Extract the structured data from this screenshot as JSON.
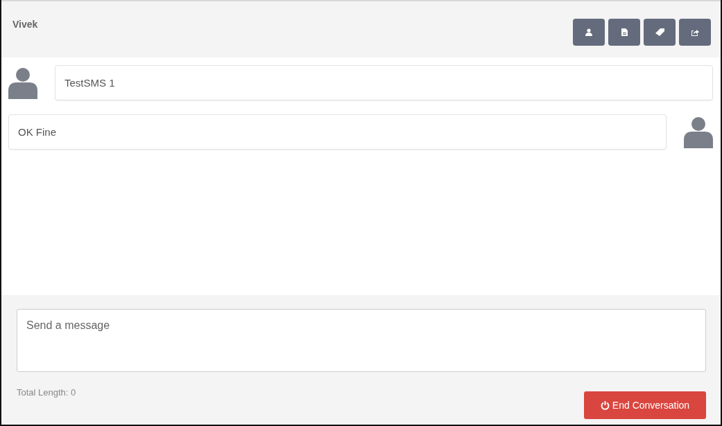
{
  "contact": {
    "name": "Vivek"
  },
  "toolbar": [
    {
      "kind": "person"
    },
    {
      "kind": "document"
    },
    {
      "kind": "tag"
    },
    {
      "kind": "share"
    }
  ],
  "messages": [
    {
      "kind": "incoming",
      "text": "TestSMS 1"
    },
    {
      "kind": "outgoing",
      "text": "OK Fine"
    }
  ],
  "composer": {
    "placeholder": "Send a message"
  },
  "total_length": "Total Length: 0",
  "end_button": {
    "label": "End Conversation"
  }
}
